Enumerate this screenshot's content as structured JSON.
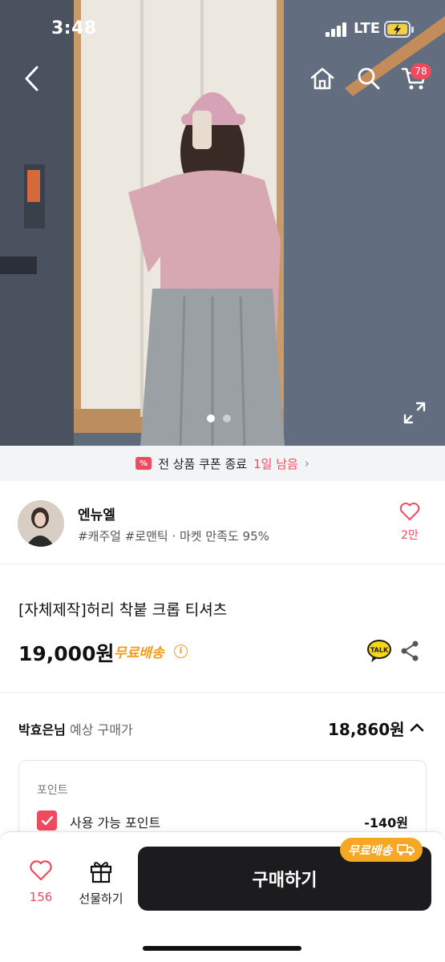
{
  "status_bar": {
    "time": "3:48",
    "network": "LTE"
  },
  "top_bar": {
    "cart_count": "78"
  },
  "gallery": {
    "page_count": 2,
    "active_index": 0
  },
  "coupon_banner": {
    "icon_text": "%",
    "prefix": "전 상품 쿠폰 종료",
    "highlight": "1일 남음",
    "arrow": "›"
  },
  "seller": {
    "name": "엔뉴엘",
    "tags": "#캐주얼 #로맨틱 · 마켓 만족도 95%",
    "likes": "2만"
  },
  "product": {
    "title": "[자체제작]허리 착붙 크롭 티셔츠",
    "price": "19,000원",
    "shipping": "무료배송",
    "info_symbol": "i",
    "talk_label": "TALK"
  },
  "expected_price": {
    "user": "박효은님",
    "label": "예상 구매가",
    "value": "18,860원"
  },
  "points": {
    "title": "포인트",
    "label": "사용 가능 포인트",
    "value": "-140원",
    "checked": true
  },
  "bottom_bar": {
    "like_count": "156",
    "gift_label": "선물하기",
    "buy_label": "구매하기",
    "shipping_pill": "무료배송"
  },
  "colors": {
    "accent": "#ef4a5e",
    "shipping": "#f39a1c",
    "buy_button": "#1c1c1e"
  }
}
